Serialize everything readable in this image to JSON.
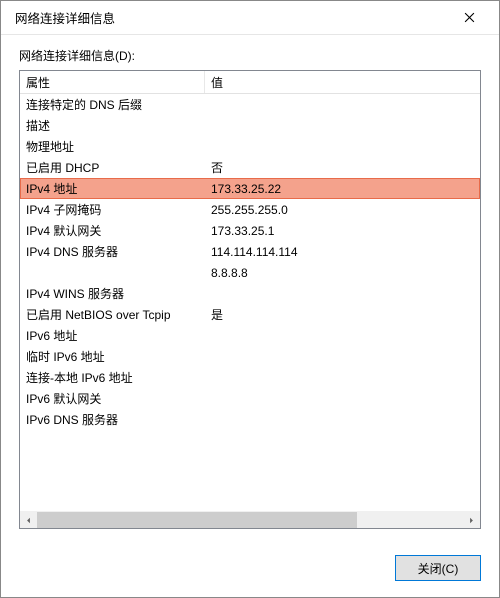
{
  "window": {
    "title": "网络连接详细信息",
    "label": "网络连接详细信息(D):",
    "close_button": "关闭(C)"
  },
  "columns": {
    "property": "属性",
    "value": "值"
  },
  "rows": [
    {
      "prop": "连接特定的 DNS 后缀",
      "val": ""
    },
    {
      "prop": "描述",
      "val": ""
    },
    {
      "prop": "物理地址",
      "val": ""
    },
    {
      "prop": "已启用 DHCP",
      "val": "否"
    },
    {
      "prop": "IPv4 地址",
      "val": "173.33.25.22",
      "highlight": true
    },
    {
      "prop": "IPv4 子网掩码",
      "val": "255.255.255.0"
    },
    {
      "prop": "IPv4 默认网关",
      "val": "173.33.25.1"
    },
    {
      "prop": "IPv4 DNS 服务器",
      "val": "114.114.114.114"
    },
    {
      "prop": "",
      "val": "8.8.8.8"
    },
    {
      "prop": "IPv4 WINS 服务器",
      "val": ""
    },
    {
      "prop": "已启用 NetBIOS over Tcpip",
      "val": "是"
    },
    {
      "prop": "IPv6 地址",
      "val": ""
    },
    {
      "prop": "临时 IPv6 地址",
      "val": ""
    },
    {
      "prop": "连接-本地 IPv6 地址",
      "val": ""
    },
    {
      "prop": "IPv6 默认网关",
      "val": ""
    },
    {
      "prop": "IPv6 DNS 服务器",
      "val": ""
    }
  ]
}
